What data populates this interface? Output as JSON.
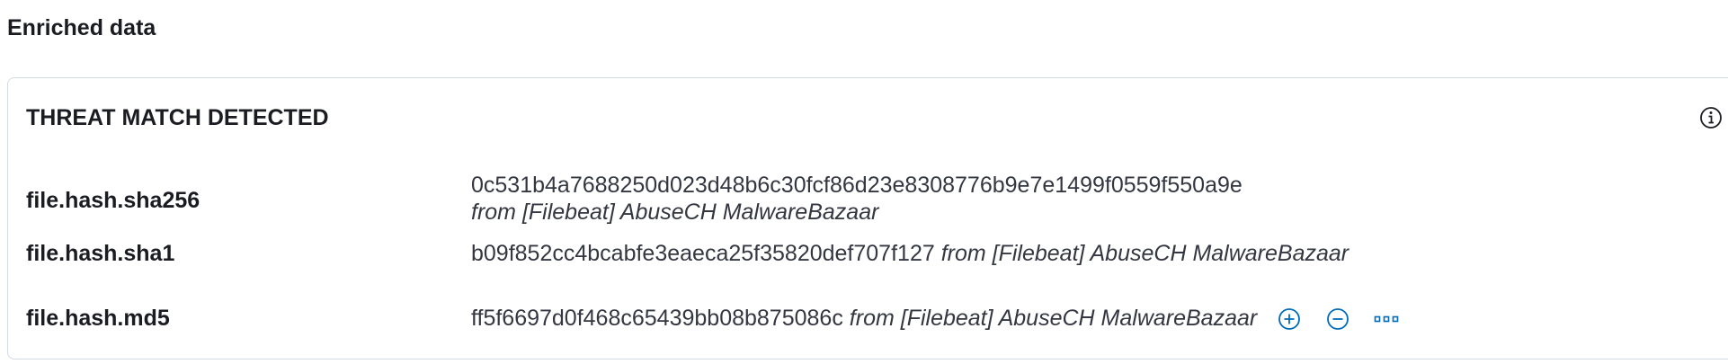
{
  "section": {
    "title": "Enriched data"
  },
  "panel": {
    "title": "THREAT MATCH DETECTED",
    "info_icon": "info-icon"
  },
  "rows": [
    {
      "field": "file.hash.sha256",
      "value": "0c531b4a7688250d023d48b6c30fcf86d23e8308776b9e7e1499f0559f550a9e",
      "source": "from [Filebeat] AbuseCH MalwareBazaar"
    },
    {
      "field": "file.hash.sha1",
      "value": "b09f852cc4bcabfe3eaeca25f35820def707f127",
      "source": "from [Filebeat] AbuseCH MalwareBazaar"
    },
    {
      "field": "file.hash.md5",
      "value": "ff5f6697d0f468c65439bb08b875086c",
      "source": "from [Filebeat] AbuseCH MalwareBazaar"
    }
  ],
  "actions": {
    "filter_in_icon": "plus-in-circle-icon",
    "filter_out_icon": "minus-in-circle-icon",
    "more_icon": "boxes-horizontal-icon"
  },
  "colors": {
    "accent": "#006bb8",
    "border": "#d3dae6",
    "text": "#1a1c21"
  }
}
